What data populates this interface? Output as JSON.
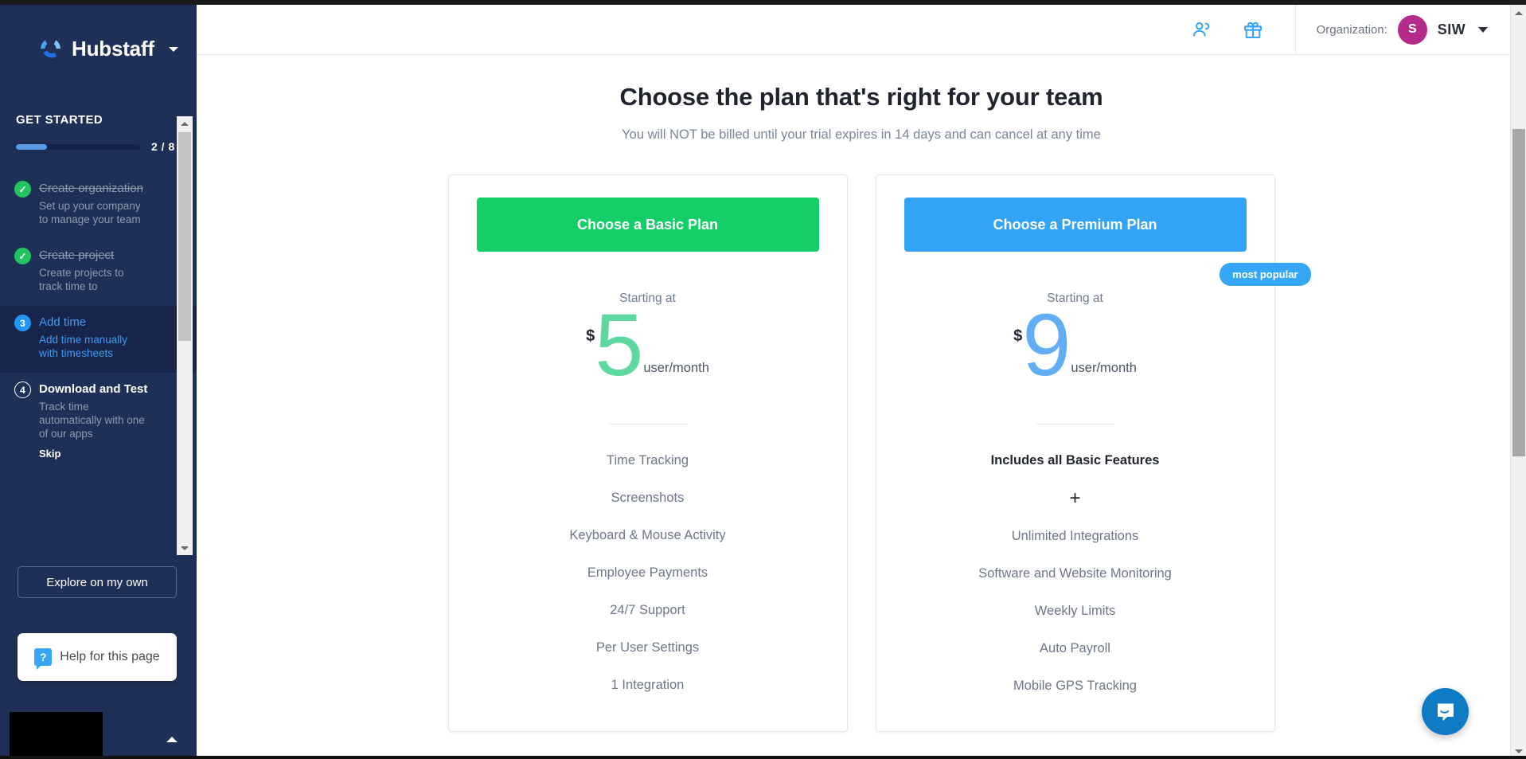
{
  "sidebar": {
    "brand": "Hubstaff",
    "brand_caret_icon": "chevron-down-icon",
    "get_started_label": "GET STARTED",
    "progress": {
      "count_label": "2 / 8",
      "completed": 2,
      "total": 8,
      "percent": 25
    },
    "steps": [
      {
        "number": "1",
        "state": "done",
        "badge_icon": "check-icon",
        "title": "Create organization",
        "desc": "Set up your company to manage your team"
      },
      {
        "number": "2",
        "state": "done",
        "badge_icon": "check-icon",
        "title": "Create project",
        "desc": "Create projects to track time to"
      },
      {
        "number": "3",
        "state": "active",
        "badge_icon": "number-3",
        "title": "Add time",
        "desc": "Add time manually with timesheets"
      },
      {
        "number": "4",
        "state": "pending",
        "badge_icon": "number-4",
        "title": "Download and Test",
        "desc": "Track time automatically with one of our apps",
        "skip_label": "Skip"
      }
    ],
    "explore_label": "Explore on my own",
    "help_label": "Help for this page",
    "help_icon": "question-mark-icon",
    "collapse_icon": "chevron-up-icon"
  },
  "topbar": {
    "invite_icon": "add-person-icon",
    "gift_icon": "gift-icon",
    "org_label": "Organization:",
    "avatar_initial": "S",
    "org_name": "SIW",
    "org_caret_icon": "chevron-down-icon"
  },
  "page": {
    "title": "Choose the plan that's right for your team",
    "subtitle": "You will NOT be billed until your trial expires in 14 days and can cancel at any time"
  },
  "plans": [
    {
      "id": "basic",
      "cta_label": "Choose a Basic Plan",
      "cta_color": "#16ce68",
      "starting_at_label": "Starting at",
      "currency": "$",
      "price": "5",
      "price_color": "#5fd8a0",
      "per_unit": "user/month",
      "badge": null,
      "features": [
        {
          "text": "Time Tracking",
          "style": "normal"
        },
        {
          "text": "Screenshots",
          "style": "normal"
        },
        {
          "text": "Keyboard & Mouse Activity",
          "style": "normal"
        },
        {
          "text": "Employee Payments",
          "style": "normal"
        },
        {
          "text": "24/7 Support",
          "style": "normal"
        },
        {
          "text": "Per User Settings",
          "style": "normal"
        },
        {
          "text": "1 Integration",
          "style": "normal"
        }
      ]
    },
    {
      "id": "premium",
      "cta_label": "Choose a Premium Plan",
      "cta_color": "#33a3f5",
      "starting_at_label": "Starting at",
      "currency": "$",
      "price": "9",
      "price_color": "#62aef4",
      "per_unit": "user/month",
      "badge": "most popular",
      "features": [
        {
          "text": "Includes all Basic Features",
          "style": "strong"
        },
        {
          "text": "+",
          "style": "plus"
        },
        {
          "text": "Unlimited Integrations",
          "style": "normal"
        },
        {
          "text": "Software and Website Monitoring",
          "style": "normal"
        },
        {
          "text": "Weekly Limits",
          "style": "normal"
        },
        {
          "text": "Auto Payroll",
          "style": "normal"
        },
        {
          "text": "Mobile GPS Tracking",
          "style": "normal"
        }
      ]
    }
  ],
  "chat": {
    "launcher_icon": "chat-bubble-icon"
  },
  "scrollbars": {
    "page_up_icon": "triangle-up-icon",
    "page_down_icon": "triangle-down-icon",
    "sidebar_up_icon": "triangle-up-icon",
    "sidebar_down_icon": "triangle-down-icon"
  }
}
